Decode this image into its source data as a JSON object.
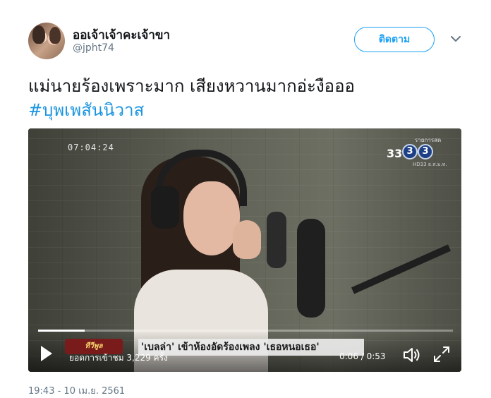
{
  "user": {
    "display_name": "ออเจ้าเจ้าคะเจ้าขา",
    "handle": "@jpht74",
    "follow_label": "ติดตาม"
  },
  "tweet": {
    "text": "แม่นายร้องเพราะมาก เสียงหวานมากอ่ะงือออ",
    "hashtag": "#บุพเพสันนิวาส",
    "timestamp": "19:43 - 10 เม.ย. 2561"
  },
  "video": {
    "on_screen_time": "07:04:24",
    "channel": {
      "top_text": "รายการสด",
      "number": "33",
      "ring1": "3",
      "ring2": "3",
      "bottom_text": "HD33 ธ.ส.ม.ท."
    },
    "show_badge": "ทีวีพูล",
    "caption": "'เบลล่า' เข้าห้องอัดร้องเพลง 'เธอหนอเธอ'",
    "views": "ยอดการเข้าชม 3,229 ครั้ง",
    "time_readout": "0:06 / 0:53",
    "progress_fraction": 0.113
  },
  "icons": {
    "play": "play-icon",
    "volume": "volume-icon",
    "fullscreen": "fullscreen-icon",
    "chevron": "chevron-down-icon"
  },
  "colors": {
    "accent": "#1da1f2",
    "hashtag": "#1b95e0",
    "muted_text": "#657786"
  }
}
